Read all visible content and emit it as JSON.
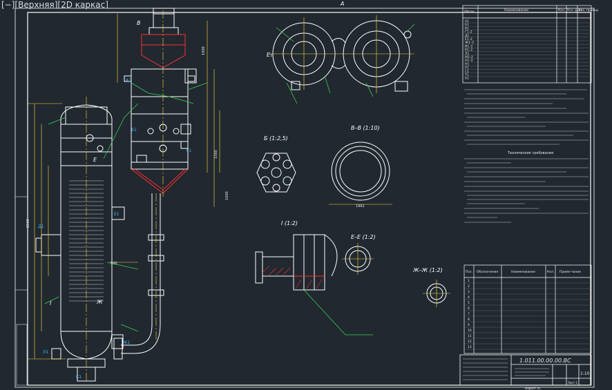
{
  "viewport": {
    "label": "[−][Верхняя][2D каркас]"
  },
  "drawing": {
    "view_labels": {
      "A_top": "А",
      "E1": "Е₁",
      "B": "Б (1:2,5)",
      "VV": "В–В (1:10)",
      "I": "I (1:2)",
      "EE": "Е–Е (1:2)",
      "ZhZh": "Ж–Ж (1:2)",
      "I_marker": "I",
      "Zh_marker": "Ж",
      "E_marker": "Е",
      "B_marker": "В"
    },
    "dims": {
      "d1": "1000",
      "d2": "2500",
      "d3": "1962",
      "d4": "500",
      "d5": "1560",
      "d6": "1000"
    },
    "title_block": {
      "code": "1.011.00.00.00.ВС",
      "scale": "1:10",
      "sheet_text": "Лист 1",
      "format": "Формат А1"
    },
    "tables": {
      "top_header": [
        "Обозн.",
        "Наименование",
        "Кол.",
        "Усл. давл.",
        "Усл. проход"
      ],
      "top_rows": [
        "А1",
        "Б1",
        "В1",
        "Г1–2",
        "Д1",
        "Е1–2",
        "Ж1–3",
        "И1–2",
        "К1–2",
        "Л1",
        "М1–2",
        "Н1–3",
        "П1",
        "Р1",
        "С1",
        "Т1",
        "У1",
        "Ф1"
      ],
      "bottom_header": [
        "Поз.",
        "Обозначение",
        "Наименование",
        "Кол.",
        "Приме-чание"
      ],
      "bottom_rows": [
        "1",
        "2",
        "3",
        "4",
        "5",
        "6",
        "7",
        "8",
        "9",
        "10",
        "11",
        "12",
        "13"
      ]
    },
    "notes_heading": "Технические требования"
  }
}
